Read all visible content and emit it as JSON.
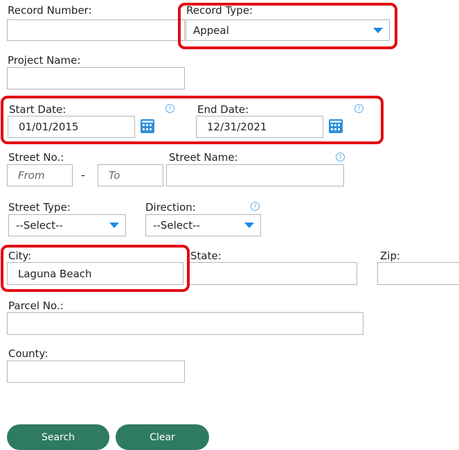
{
  "form": {
    "record_number": {
      "label": "Record Number:",
      "value": ""
    },
    "record_type": {
      "label": "Record Type:",
      "value": "Appeal"
    },
    "project_name": {
      "label": "Project Name:",
      "value": ""
    },
    "start_date": {
      "label": "Start Date:",
      "value": "01/01/2015"
    },
    "end_date": {
      "label": "End Date:",
      "value": "12/31/2021"
    },
    "street_no": {
      "label": "Street No.:",
      "from_placeholder": "From",
      "to_placeholder": "To",
      "separator": "-"
    },
    "street_name": {
      "label": "Street Name:",
      "value": ""
    },
    "street_type": {
      "label": "Street Type:",
      "value": "--Select--"
    },
    "direction": {
      "label": "Direction:",
      "value": "--Select--"
    },
    "city": {
      "label": "City:",
      "value": "Laguna Beach"
    },
    "state": {
      "label": "State:",
      "value": ""
    },
    "zip": {
      "label": "Zip:",
      "value": ""
    },
    "parcel_no": {
      "label": "Parcel No.:",
      "value": ""
    },
    "county": {
      "label": "County:",
      "value": ""
    }
  },
  "help_icon_glyph": "?",
  "buttons": {
    "search": "Search",
    "clear": "Clear"
  },
  "colors": {
    "highlight": "#e30613",
    "button": "#2e7a63",
    "accent": "#1e88e5"
  }
}
